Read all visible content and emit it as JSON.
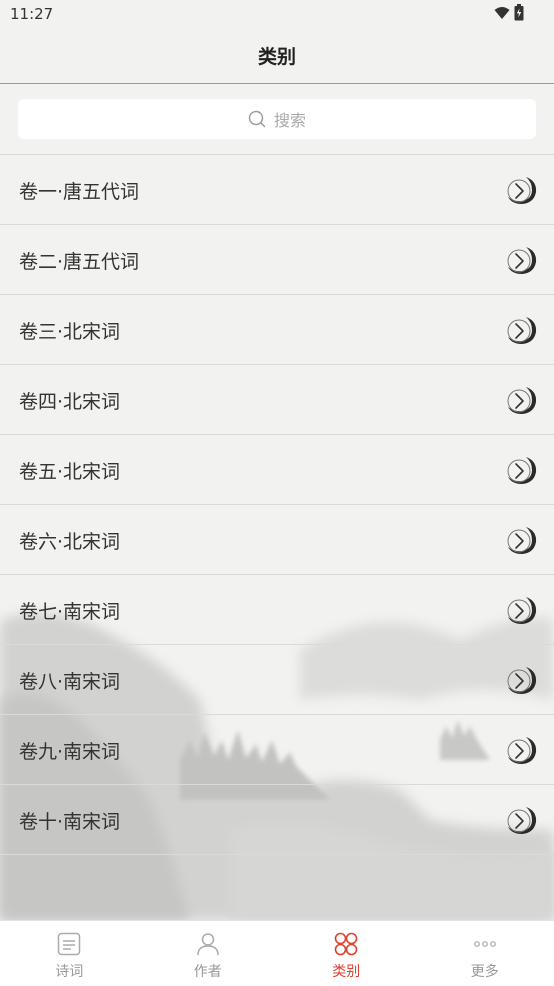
{
  "status_bar": {
    "time": "11:27"
  },
  "header": {
    "title": "类别"
  },
  "search": {
    "placeholder": "搜索",
    "icon": "search-icon"
  },
  "categories": [
    {
      "label": "卷一·唐五代词"
    },
    {
      "label": "卷二·唐五代词"
    },
    {
      "label": "卷三·北宋词"
    },
    {
      "label": "卷四·北宋词"
    },
    {
      "label": "卷五·北宋词"
    },
    {
      "label": "卷六·北宋词"
    },
    {
      "label": "卷七·南宋词"
    },
    {
      "label": "卷八·南宋词"
    },
    {
      "label": "卷九·南宋词"
    },
    {
      "label": "卷十·南宋词"
    }
  ],
  "tabbar": {
    "tabs": [
      {
        "label": "诗词",
        "icon": "poem-icon",
        "active": false
      },
      {
        "label": "作者",
        "icon": "person-icon",
        "active": false
      },
      {
        "label": "类别",
        "icon": "category-icon",
        "active": true
      },
      {
        "label": "更多",
        "icon": "more-icon",
        "active": false
      }
    ]
  },
  "colors": {
    "accent": "#e0402c",
    "background": "#f1f1ef",
    "inactive_tab": "#999999"
  }
}
